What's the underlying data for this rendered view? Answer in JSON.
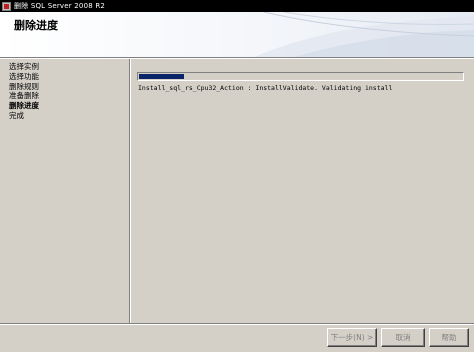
{
  "window": {
    "title": "删除 SQL Server 2008 R2"
  },
  "header": {
    "page_title": "删除进度"
  },
  "sidebar": {
    "steps": [
      {
        "label": "选择实例"
      },
      {
        "label": "选择功能"
      },
      {
        "label": "删除规则"
      },
      {
        "label": "准备删除"
      },
      {
        "label": "删除进度"
      },
      {
        "label": "完成"
      }
    ],
    "current_step": "删除进度"
  },
  "main": {
    "progress_fraction": 0.14,
    "status_text": "Install_sql_rs_Cpu32_Action : InstallValidate. Validating install"
  },
  "footer": {
    "next_label": "下一步(N) >",
    "cancel_label": "取消",
    "help_label": "帮助"
  },
  "colors": {
    "progress_fill": "#0a246a",
    "titlebar_bg": "#000000",
    "dialog_bg": "#d4d0c8"
  }
}
